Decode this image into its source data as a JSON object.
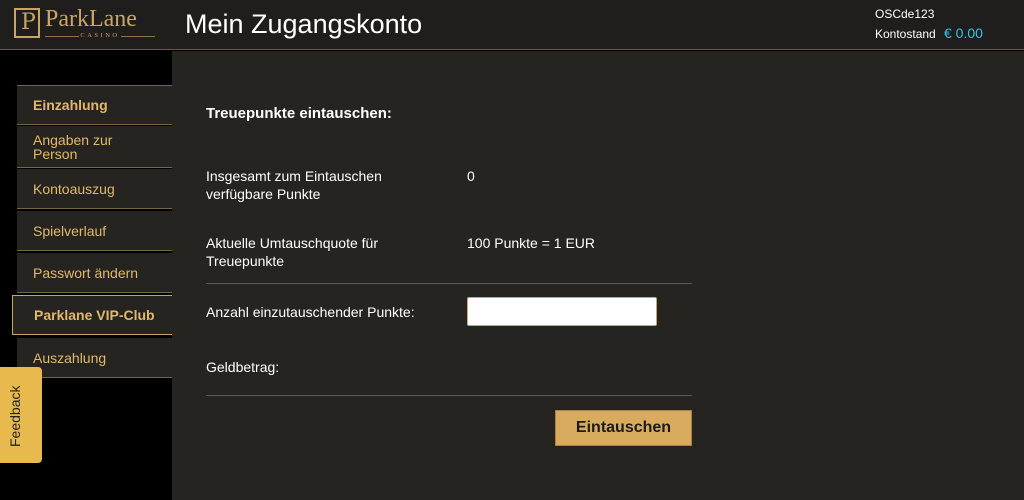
{
  "brand": {
    "name": "ParkLane",
    "sub": "CASINO",
    "monogram": "P"
  },
  "header": {
    "title": "Mein Zugangskonto",
    "user_id": "OSCde123",
    "balance_label": "Kontostand",
    "balance_value": "€ 0.00"
  },
  "sidebar": {
    "items": [
      {
        "label": "Einzahlung"
      },
      {
        "label": "Angaben zur Person"
      },
      {
        "label": "Kontoauszug"
      },
      {
        "label": "Spielverlauf"
      },
      {
        "label": "Passwort ändern"
      },
      {
        "label": "Parklane VIP-Club"
      },
      {
        "label": "Auszahlung"
      }
    ]
  },
  "feedback": {
    "label": "Feedback"
  },
  "main": {
    "section_title": "Treuepunkte eintauschen:",
    "available_label": "Insgesamt zum Eintauschen verfügbare Punkte",
    "available_value": "0",
    "rate_label": "Aktuelle Umtauschquote für Treuepunkte",
    "rate_value": "100 Punkte = 1 EUR",
    "points_label": "Anzahl einzutauschender Punkte:",
    "points_value": "",
    "amount_label": "Geldbetrag:",
    "submit_label": "Eintauschen"
  },
  "colors": {
    "accent_gold": "#c9a664",
    "nav_text": "#e3b86a",
    "balance_blue": "#38c0e8",
    "button_bg": "#d8ab5e",
    "feedback_bg": "#e8b94c"
  }
}
